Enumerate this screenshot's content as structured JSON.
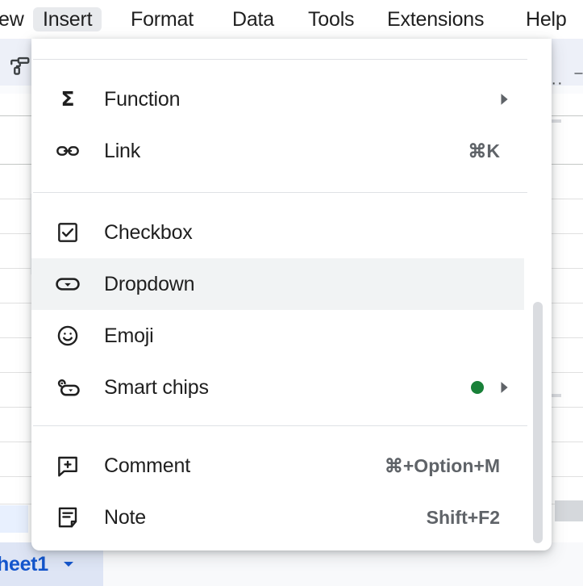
{
  "menubar": {
    "items": [
      {
        "label": "ew",
        "active": false,
        "name": "menu-view-clipped"
      },
      {
        "label": "Insert",
        "active": true,
        "name": "menu-insert"
      },
      {
        "label": "Format",
        "active": false,
        "name": "menu-format"
      },
      {
        "label": "Data",
        "active": false,
        "name": "menu-data"
      },
      {
        "label": "Tools",
        "active": false,
        "name": "menu-tools"
      },
      {
        "label": "Extensions",
        "active": false,
        "name": "menu-extensions"
      },
      {
        "label": "Help",
        "active": false,
        "name": "menu-help"
      }
    ]
  },
  "toolbar": {
    "paint_format_icon": "paint-roller-icon",
    "more_label": "··",
    "more_icon": "more-options-icon"
  },
  "insert_menu": {
    "groups": [
      {
        "items": [
          {
            "label": "Function",
            "icon": "sigma-icon",
            "accel": "",
            "submenu": true,
            "badge": false,
            "highlight": false
          },
          {
            "label": "Link",
            "icon": "link-icon",
            "accel": "⌘K",
            "submenu": false,
            "badge": false,
            "highlight": false
          }
        ]
      },
      {
        "items": [
          {
            "label": "Checkbox",
            "icon": "checkbox-icon",
            "accel": "",
            "submenu": false,
            "badge": false,
            "highlight": false
          },
          {
            "label": "Dropdown",
            "icon": "dropdown-icon",
            "accel": "",
            "submenu": false,
            "badge": false,
            "highlight": true
          },
          {
            "label": "Emoji",
            "icon": "emoji-icon",
            "accel": "",
            "submenu": false,
            "badge": false,
            "highlight": false
          },
          {
            "label": "Smart chips",
            "icon": "smart-chips-icon",
            "accel": "",
            "submenu": true,
            "badge": true,
            "highlight": false
          }
        ]
      },
      {
        "items": [
          {
            "label": "Comment",
            "icon": "comment-plus-icon",
            "accel": "⌘+Option+M",
            "submenu": false,
            "badge": false,
            "highlight": false
          },
          {
            "label": "Note",
            "icon": "note-icon",
            "accel": "Shift+F2",
            "submenu": false,
            "badge": false,
            "highlight": false
          }
        ]
      }
    ],
    "badge_color": "#188038",
    "highlight_color": "#f1f3f4",
    "scrollbar": {
      "visible": true
    }
  },
  "sheet_tab": {
    "name": "heet1",
    "caret_icon": "chevron-down-icon",
    "color": "#1355cc"
  }
}
